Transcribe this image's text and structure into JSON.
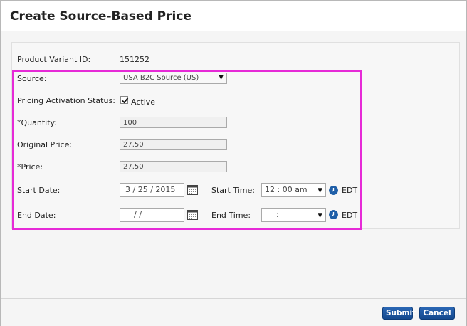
{
  "dialog": {
    "title": "Create Source-Based Price"
  },
  "form": {
    "product_variant_label": "Product Variant ID:",
    "product_variant_value": "151252",
    "source_label": "Source:",
    "source_value": "USA B2C Source (US)",
    "activation_label": "Pricing Activation Status:",
    "activation_checked": true,
    "activation_text": "Active",
    "quantity_label": "*Quantity:",
    "quantity_value": "100",
    "original_price_label": "Original Price:",
    "original_price_value": "27.50",
    "price_label": "*Price:",
    "price_value": "27.50",
    "start_date_label": "Start Date:",
    "start_date_value": "3  / 25 /  2015",
    "end_date_label": "End Date:",
    "end_date_value": "/     /",
    "start_time_label": "Start Time:",
    "start_time_value": "12 : 00   am",
    "end_time_label": "End Time:",
    "end_time_value": ":",
    "timezone": "EDT"
  },
  "footer": {
    "submit_label": "Submit",
    "cancel_label": "Cancel"
  },
  "icons": {
    "calendar": "calendar-icon",
    "clock": "clock-icon",
    "dropdown": "chevron-down-icon",
    "check": "checkmark-icon"
  },
  "colors": {
    "highlight": "#e62ad7",
    "button": "#1f5fa8",
    "clock": "#1f5fa8"
  }
}
